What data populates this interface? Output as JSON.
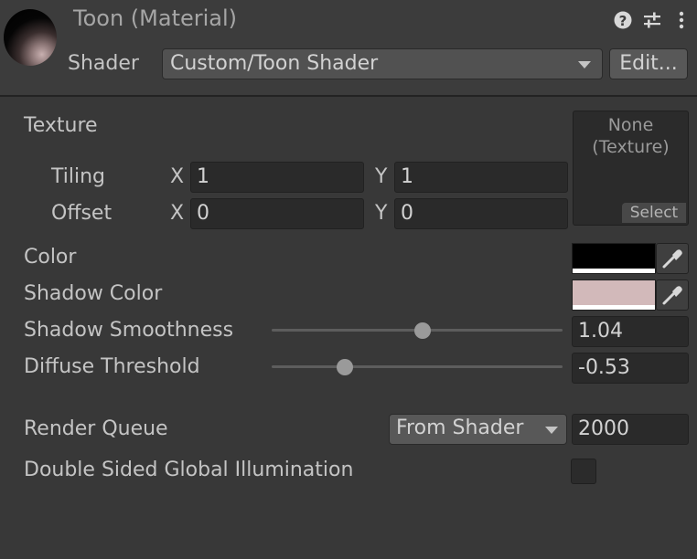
{
  "header": {
    "title": "Toon (Material)",
    "shader_label": "Shader",
    "shader_value": "Custom/Toon Shader",
    "edit_label": "Edit..."
  },
  "texture": {
    "label": "Texture",
    "slot_text": "None\n(Texture)",
    "select_label": "Select",
    "tiling": {
      "label": "Tiling",
      "x_label": "X",
      "x": "1",
      "y_label": "Y",
      "y": "1"
    },
    "offset": {
      "label": "Offset",
      "x_label": "X",
      "x": "0",
      "y_label": "Y",
      "y": "0"
    }
  },
  "color": {
    "label": "Color",
    "value": "#000000"
  },
  "shadow_color": {
    "label": "Shadow Color",
    "value": "#d2b9ba"
  },
  "shadow_smoothness": {
    "label": "Shadow Smoothness",
    "value": "1.04",
    "fraction": 0.52
  },
  "diffuse_threshold": {
    "label": "Diffuse Threshold",
    "value": "-0.53",
    "fraction": 0.25
  },
  "render_queue": {
    "label": "Render Queue",
    "mode": "From Shader",
    "value": "2000"
  },
  "double_sided_gi": {
    "label": "Double Sided Global Illumination",
    "checked": false
  },
  "icons": [
    "material-preview-icon",
    "help-icon",
    "preset-sliders-icon",
    "kebab-menu-icon",
    "chevron-down-icon",
    "eyedropper-icon"
  ]
}
